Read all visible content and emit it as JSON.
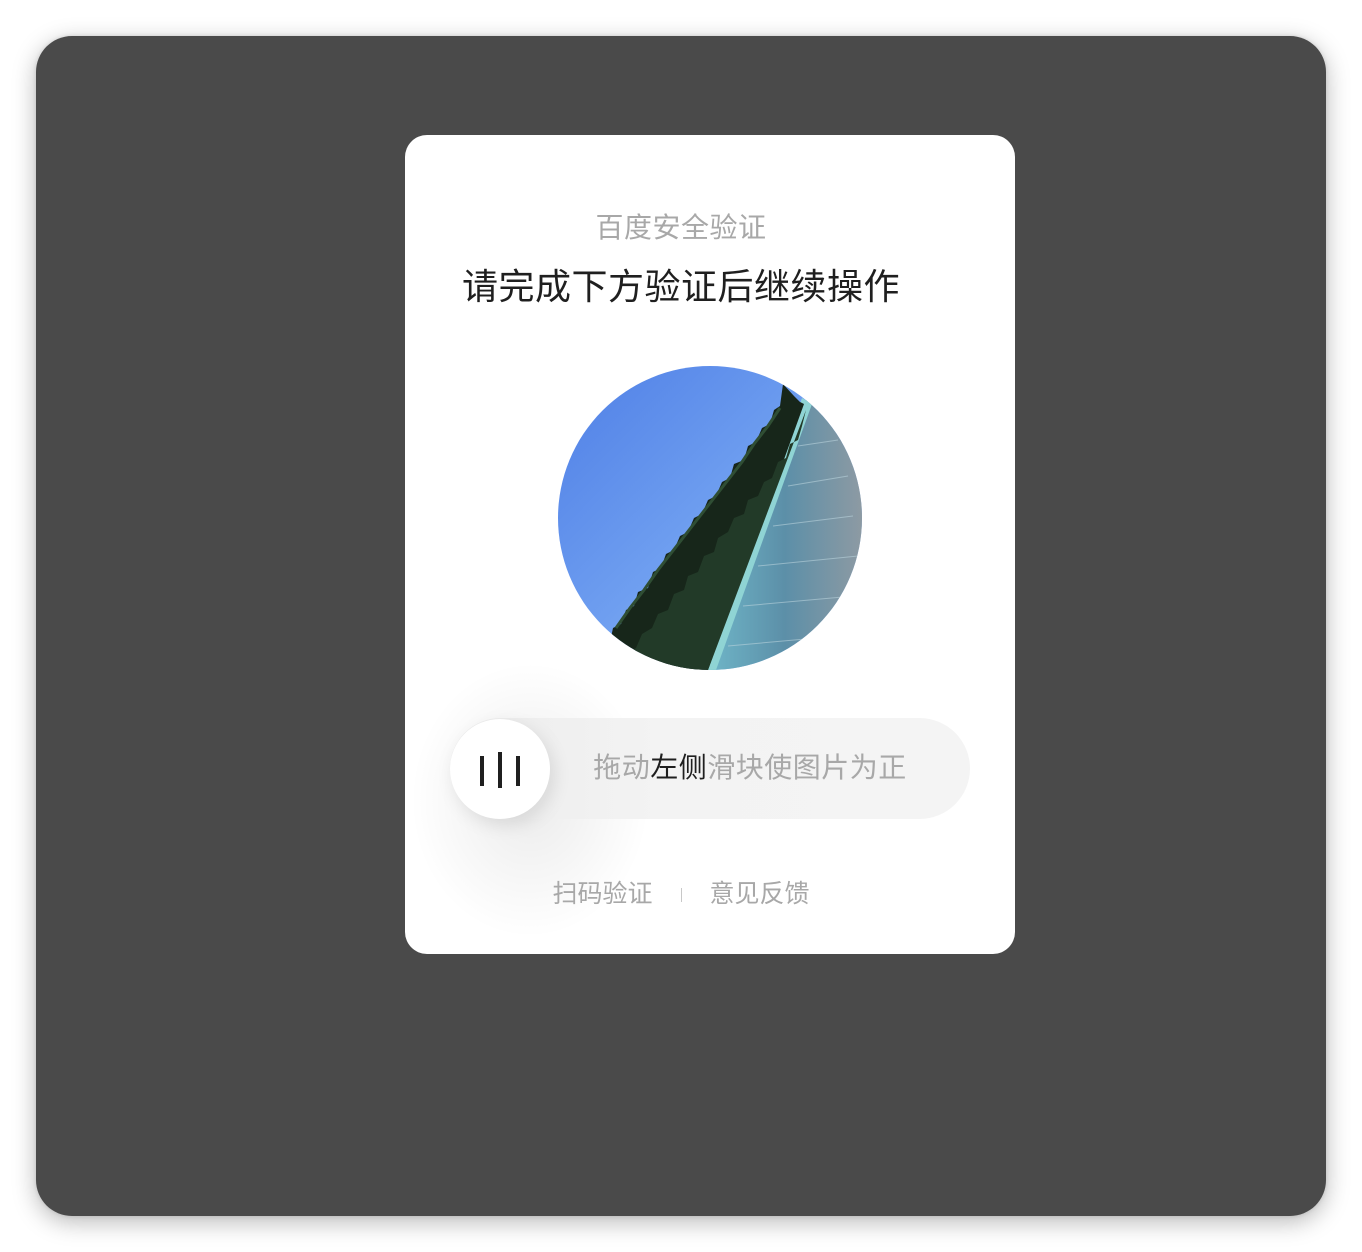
{
  "dialog": {
    "subtitle": "百度安全验证",
    "title": "请完成下方验证后继续操作"
  },
  "slider": {
    "hint_prefix": "拖动",
    "hint_highlight": "左侧",
    "hint_suffix": "滑块使图片为正",
    "handle_icon": "grip-bars-icon"
  },
  "footer": {
    "scan_verify": "扫码验证",
    "feedback": "意见反馈"
  },
  "colors": {
    "backdrop": "#4a4a4a",
    "card": "#ffffff",
    "muted_text": "#a8a8a8",
    "primary_text": "#1f1f1f",
    "track": "#f2f2f2"
  }
}
